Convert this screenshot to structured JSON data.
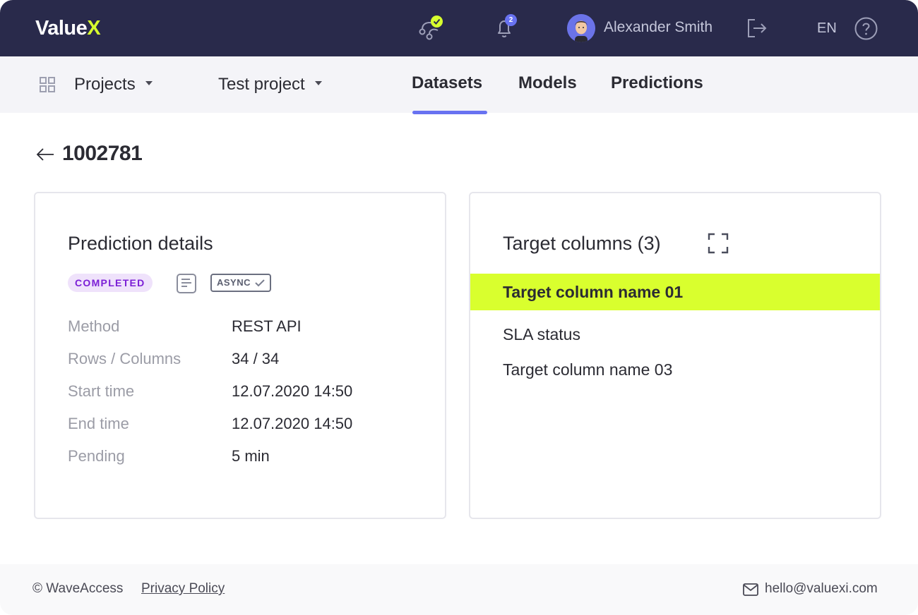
{
  "header": {
    "logo_main": "Value",
    "logo_accent": "X",
    "notifications_count": "2",
    "user_name": "Alexander Smith",
    "language": "EN",
    "colors": {
      "bar": "#292a4b",
      "accent": "#d7ff2e",
      "badge": "#6872f1"
    }
  },
  "subnav": {
    "projects_label": "Projects",
    "project_label": "Test project",
    "tabs": [
      {
        "label": "Datasets",
        "active": true
      },
      {
        "label": "Models",
        "active": false
      },
      {
        "label": "Predictions",
        "active": false
      }
    ]
  },
  "page": {
    "title": "1002781"
  },
  "details": {
    "title": "Prediction details",
    "status": "COMPLETED",
    "mode_badge": "ASYNC",
    "rows": [
      {
        "label": "Method",
        "value": "REST API"
      },
      {
        "label": "Rows / Columns",
        "value": "34 / 34"
      },
      {
        "label": "Start time",
        "value": "12.07.2020 14:50"
      },
      {
        "label": "End time",
        "value": "12.07.2020 14:50"
      },
      {
        "label": "Pending",
        "value": "5 min"
      }
    ]
  },
  "targets": {
    "title": "Target columns (3)",
    "items": [
      {
        "label": "Target column name 01",
        "selected": true
      },
      {
        "label": "SLA status",
        "selected": false
      },
      {
        "label": "Target column name 03",
        "selected": false
      }
    ]
  },
  "footer": {
    "copyright": "© WaveAccess",
    "privacy": "Privacy Policy",
    "email": "hello@valuexi.com"
  }
}
